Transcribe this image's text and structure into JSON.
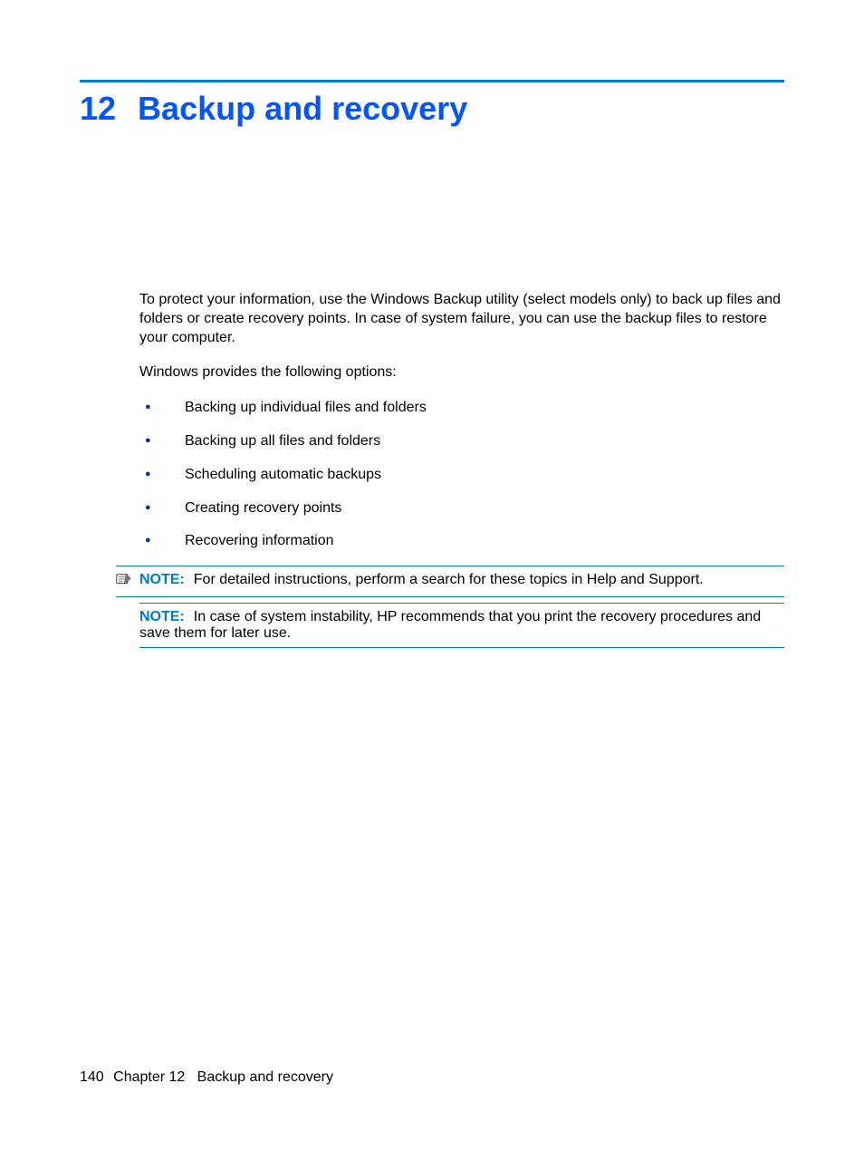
{
  "chapter": {
    "number": "12",
    "title": "Backup and recovery"
  },
  "paragraphs": {
    "intro": "To protect your information, use the Windows Backup utility (select models only) to back up files and folders or create recovery points. In case of system failure, you can use the backup files to restore your computer.",
    "options_lead": "Windows provides the following options:"
  },
  "bullets": [
    "Backing up individual files and folders",
    "Backing up all files and folders",
    "Scheduling automatic backups",
    "Creating recovery points",
    "Recovering information"
  ],
  "notes": {
    "label": "NOTE:",
    "first": "For detailed instructions, perform a search for these topics in Help and Support.",
    "second": "In case of system instability, HP recommends that you print the recovery procedures and save them for later use."
  },
  "footer": {
    "page": "140",
    "chapter_label": "Chapter 12",
    "chapter_title": "Backup and recovery"
  }
}
